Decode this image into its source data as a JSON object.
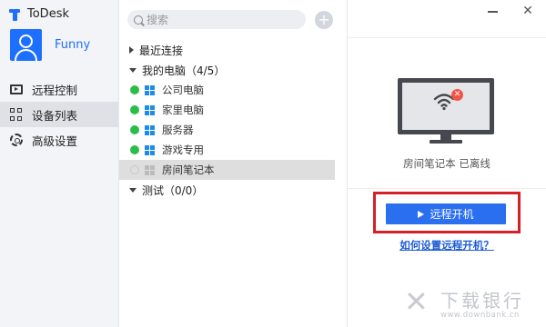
{
  "app": {
    "title": "ToDesk"
  },
  "user": {
    "name": "Funny"
  },
  "sidebar": {
    "items": [
      {
        "label": "远程控制",
        "icon": "remote-control-icon",
        "active": false
      },
      {
        "label": "设备列表",
        "icon": "device-list-icon",
        "active": true
      },
      {
        "label": "高级设置",
        "icon": "gear-icon",
        "active": false
      }
    ]
  },
  "search": {
    "placeholder": "搜索"
  },
  "tree": {
    "recent": "最近连接",
    "my_computers": "我的电脑（4/5）",
    "test": "测试（0/0）",
    "devices": [
      {
        "name": "公司电脑",
        "online": true
      },
      {
        "name": "家里电脑",
        "online": true
      },
      {
        "name": "服务器",
        "online": true
      },
      {
        "name": "游戏专用",
        "online": true
      },
      {
        "name": "房间笔记本",
        "online": false,
        "selected": true
      }
    ]
  },
  "detail": {
    "status": "房间笔记本  已离线",
    "wake_button": "远程开机",
    "help_link": "如何设置远程开机？"
  },
  "watermark": {
    "name": "下载银行",
    "url": "www.downbank.cn"
  },
  "colors": {
    "accent": "#2a6ff0",
    "online": "#2bbd4a",
    "alert": "#d61f27"
  }
}
